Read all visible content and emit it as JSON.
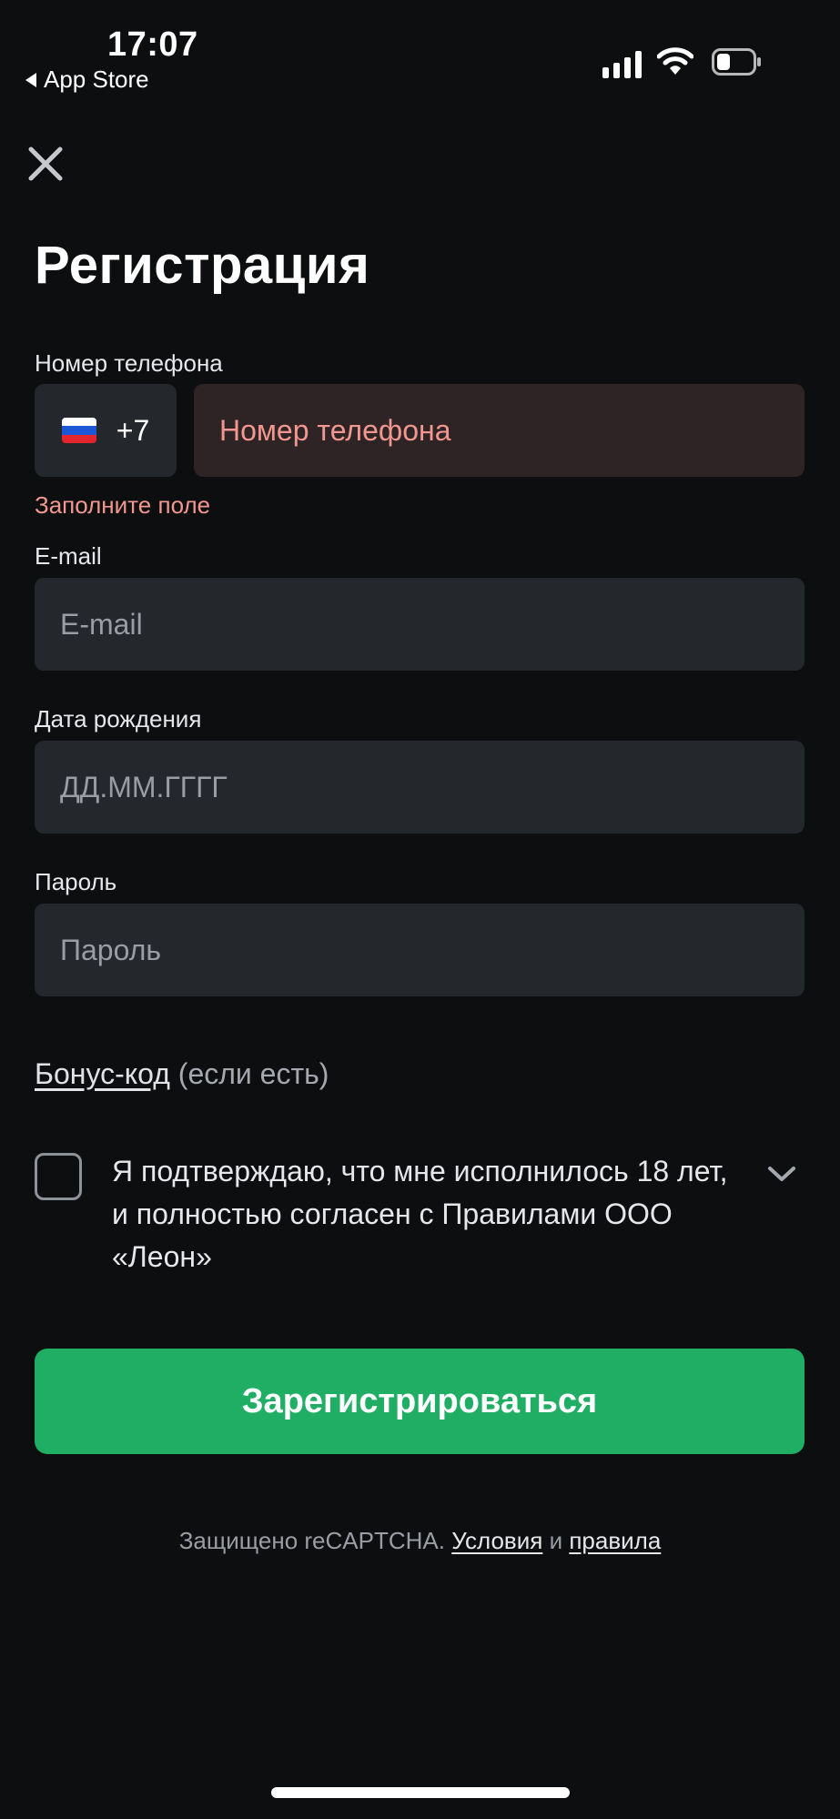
{
  "status_bar": {
    "time": "17:07",
    "back_app_label": "App Store"
  },
  "title": "Регистрация",
  "phone": {
    "label": "Номер телефона",
    "country_code": "+7",
    "country_flag": "russia-flag-icon",
    "placeholder": "Номер телефона",
    "error": "Заполните поле"
  },
  "email": {
    "label": "E-mail",
    "placeholder": "E-mail"
  },
  "birthdate": {
    "label": "Дата рождения",
    "placeholder": "ДД.ММ.ГГГГ"
  },
  "password": {
    "label": "Пароль",
    "placeholder": "Пароль"
  },
  "bonus": {
    "link": "Бонус-код",
    "hint": "(если есть)"
  },
  "consent": {
    "text": "Я подтверждаю, что мне исполнилось 18 лет, и полностью согласен с Правилами ООО «Леон»",
    "checked": false
  },
  "register_button": "Зарегистрироваться",
  "captcha": {
    "prefix": "Защищено reCAPTCHA.",
    "terms_link": "Условия",
    "and": "и",
    "rules_link": "правила"
  },
  "colors": {
    "background": "#0d0e10",
    "field": "#24272c",
    "error_field": "#2e2426",
    "error_text": "#f2978f",
    "accent": "#1fae64"
  }
}
